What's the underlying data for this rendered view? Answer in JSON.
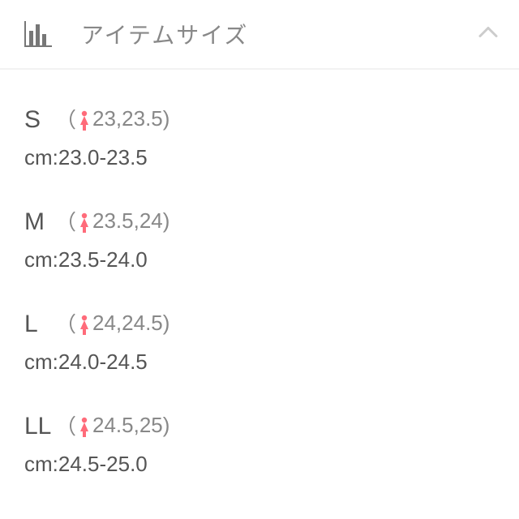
{
  "header": {
    "title": "アイテムサイズ"
  },
  "sizes": [
    {
      "label": "S",
      "paren": "23,23.5",
      "cm": "cm:23.0-23.5"
    },
    {
      "label": "M",
      "paren": "23.5,24",
      "cm": "cm:23.5-24.0"
    },
    {
      "label": "L",
      "paren": "24,24.5",
      "cm": "cm:24.0-24.5"
    },
    {
      "label": "LL",
      "paren": "24.5,25",
      "cm": "cm:24.5-25.0"
    }
  ]
}
